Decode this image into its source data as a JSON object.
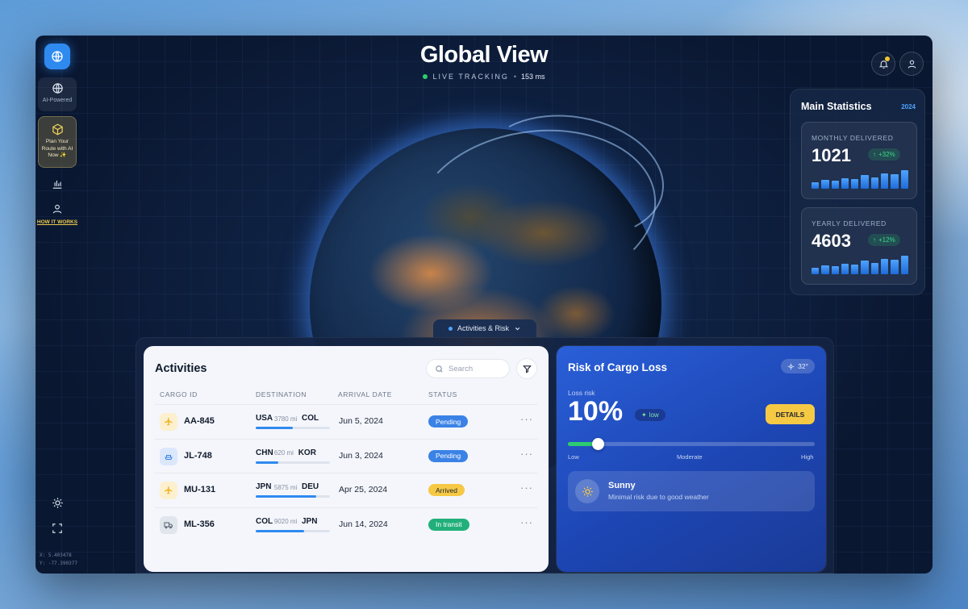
{
  "header": {
    "title": "Global View",
    "live_label": "LIVE TRACKING",
    "separator": "•",
    "latency": "153 ms"
  },
  "sidebar": {
    "ai_label": "AI-Powered",
    "plan_label": "Plan Your Route with AI Now ✨",
    "how_label": "HOW IT WORKS",
    "coords": {
      "x": "X: 5.403478",
      "y": "Y: -77.390377"
    }
  },
  "stats": {
    "title": "Main Statistics",
    "year": "2024",
    "monthly": {
      "label": "MONTHLY DELIVERED",
      "value": "1021",
      "change": "+32%",
      "bars": [
        0.35,
        0.45,
        0.4,
        0.55,
        0.5,
        0.7,
        0.6,
        0.8,
        0.75,
        0.95
      ]
    },
    "yearly": {
      "label": "YEARLY DELIVERED",
      "value": "4603",
      "change": "+12%",
      "bars": [
        0.35,
        0.45,
        0.4,
        0.55,
        0.5,
        0.7,
        0.6,
        0.8,
        0.75,
        0.95
      ]
    }
  },
  "tray_tab": {
    "label": "Activities & Risk"
  },
  "activities": {
    "title": "Activities",
    "search_placeholder": "Search",
    "columns": {
      "cargo_id": "CARGO ID",
      "destination": "DESTINATION",
      "arrival": "ARRIVAL DATE",
      "status": "STATUS"
    },
    "rows": [
      {
        "id": "AA-845",
        "from": "USA",
        "distance": "3780 mi",
        "to": "COL",
        "progress": 0.5,
        "date": "Jun 5, 2024",
        "status": "Pending",
        "icon": "plane-icon"
      },
      {
        "id": "JL-748",
        "from": "CHN",
        "distance": "620 mi",
        "to": "KOR",
        "progress": 0.3,
        "date": "Jun 3, 2024",
        "status": "Pending",
        "icon": "ship-icon"
      },
      {
        "id": "MU-131",
        "from": "JPN",
        "distance": "5875 mi",
        "to": "DEU",
        "progress": 0.82,
        "date": "Apr 25, 2024",
        "status": "Arrived",
        "icon": "plane-icon"
      },
      {
        "id": "ML-356",
        "from": "COL",
        "distance": "9020 mi",
        "to": "JPN",
        "progress": 0.65,
        "date": "Jun 14, 2024",
        "status": "In transit",
        "icon": "truck-icon"
      }
    ],
    "more_label": "···"
  },
  "risk": {
    "title": "Risk of Cargo Loss",
    "temperature": "32°",
    "loss_label": "Loss risk",
    "value": "10%",
    "level": "low",
    "details_label": "DETAILS",
    "slider_value": 0.12,
    "scale": {
      "low": "Low",
      "moderate": "Moderate",
      "high": "High"
    },
    "weather": {
      "title": "Sunny",
      "subtitle": "Minimal risk due to good weather"
    }
  },
  "colors": {
    "accent": "#2f8af0",
    "pending": "#3b82e6",
    "arrived": "#f6c945",
    "transit": "#22b07a",
    "highlight": "#f6c945"
  }
}
